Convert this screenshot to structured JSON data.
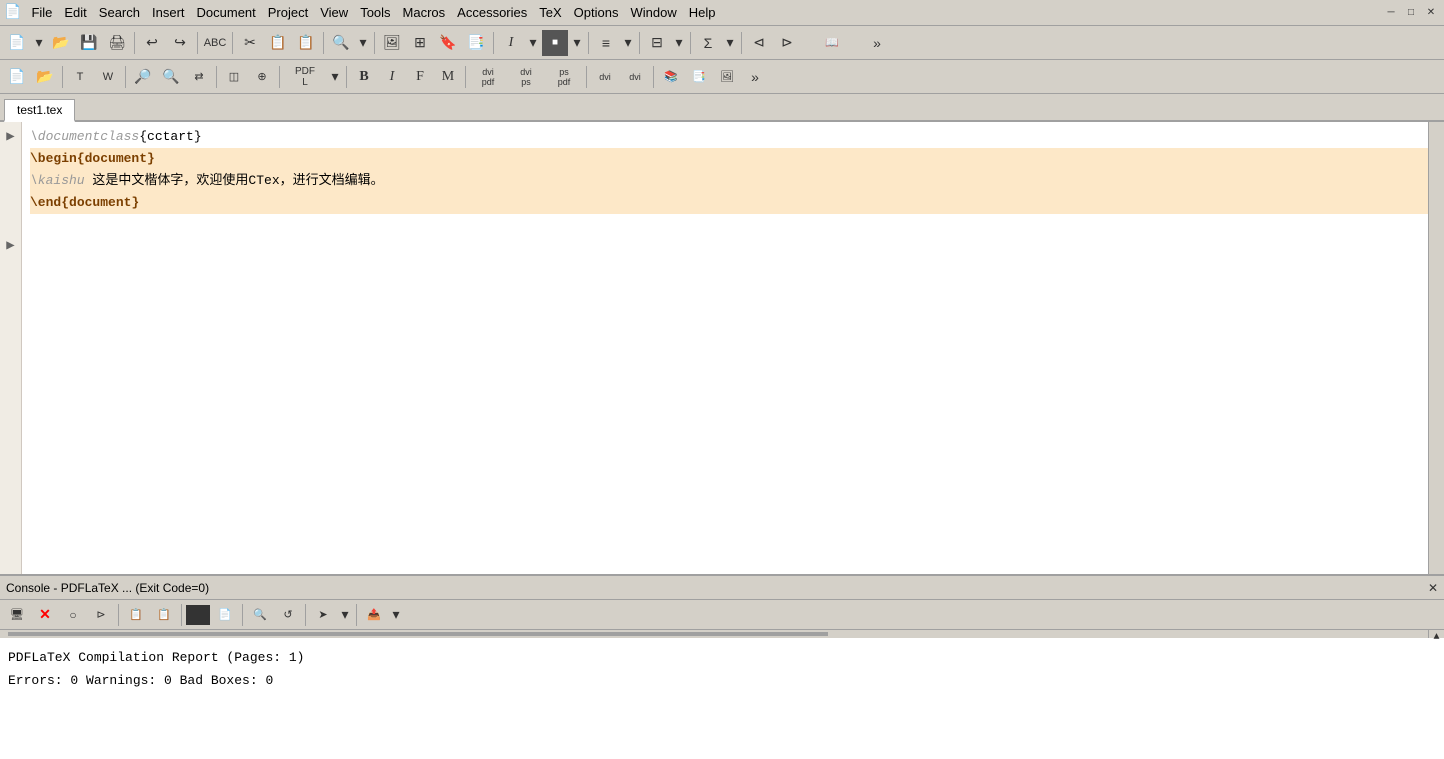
{
  "menubar": {
    "items": [
      {
        "label": "File",
        "id": "file"
      },
      {
        "label": "Edit",
        "id": "edit"
      },
      {
        "label": "Search",
        "id": "search"
      },
      {
        "label": "Insert",
        "id": "insert"
      },
      {
        "label": "Document",
        "id": "document"
      },
      {
        "label": "Project",
        "id": "project"
      },
      {
        "label": "View",
        "id": "view"
      },
      {
        "label": "Tools",
        "id": "tools"
      },
      {
        "label": "Macros",
        "id": "macros"
      },
      {
        "label": "Accessories",
        "id": "accessories"
      },
      {
        "label": "TeX",
        "id": "tex"
      },
      {
        "label": "Options",
        "id": "options"
      },
      {
        "label": "Window",
        "id": "window"
      },
      {
        "label": "Help",
        "id": "help"
      }
    ]
  },
  "toolbar1": {
    "buttons": [
      "new",
      "open-dropdown",
      "save",
      "print",
      "undo",
      "redo",
      "spell",
      "cut",
      "copy",
      "paste",
      "find",
      "find-dropdown",
      "image",
      "table",
      "ref",
      "cite",
      "sep",
      "italic",
      "italic-dropdown",
      "bold-block",
      "bold-block-dropdown",
      "list",
      "list-dropdown",
      "table2",
      "table2-dropdown",
      "sum",
      "sum-dropdown",
      "nav1",
      "nav2",
      "nav3",
      "more"
    ]
  },
  "toolbar2": {
    "buttons": [
      "new2",
      "open2",
      "template",
      "wizard",
      "zoom-in",
      "zoom-out",
      "search2",
      "replace",
      "structure",
      "sep",
      "pdf-dropdown",
      "bold-b",
      "italic-i",
      "font-f",
      "font-m",
      "dvi-pdf",
      "dvi-ps",
      "ps-pdf",
      "dvi-view",
      "dvi-view2",
      "bibtex",
      "makeindex",
      "preview",
      "more2"
    ]
  },
  "tab": {
    "label": "test1.tex"
  },
  "editor": {
    "lines": [
      {
        "text": "\\documentclass{cctart}",
        "highlighted": false
      },
      {
        "text": "\\begin{document}",
        "highlighted": true
      },
      {
        "text": "\\kaishu 这是中文楷体字，欢迎使用CTex，进行文档编辑。",
        "highlighted": true
      },
      {
        "text": "\\end{document}",
        "highlighted": true
      }
    ],
    "gutter_arrows": [
      "▶",
      "▶"
    ]
  },
  "console": {
    "title": "Console - PDFLaTeX ... (Exit Code=0)",
    "close_label": "✕",
    "report_line1": "PDFLaTeX Compilation Report (Pages: 1)",
    "report_line2": "Errors: 0    Warnings: 0    Bad Boxes: 0"
  }
}
